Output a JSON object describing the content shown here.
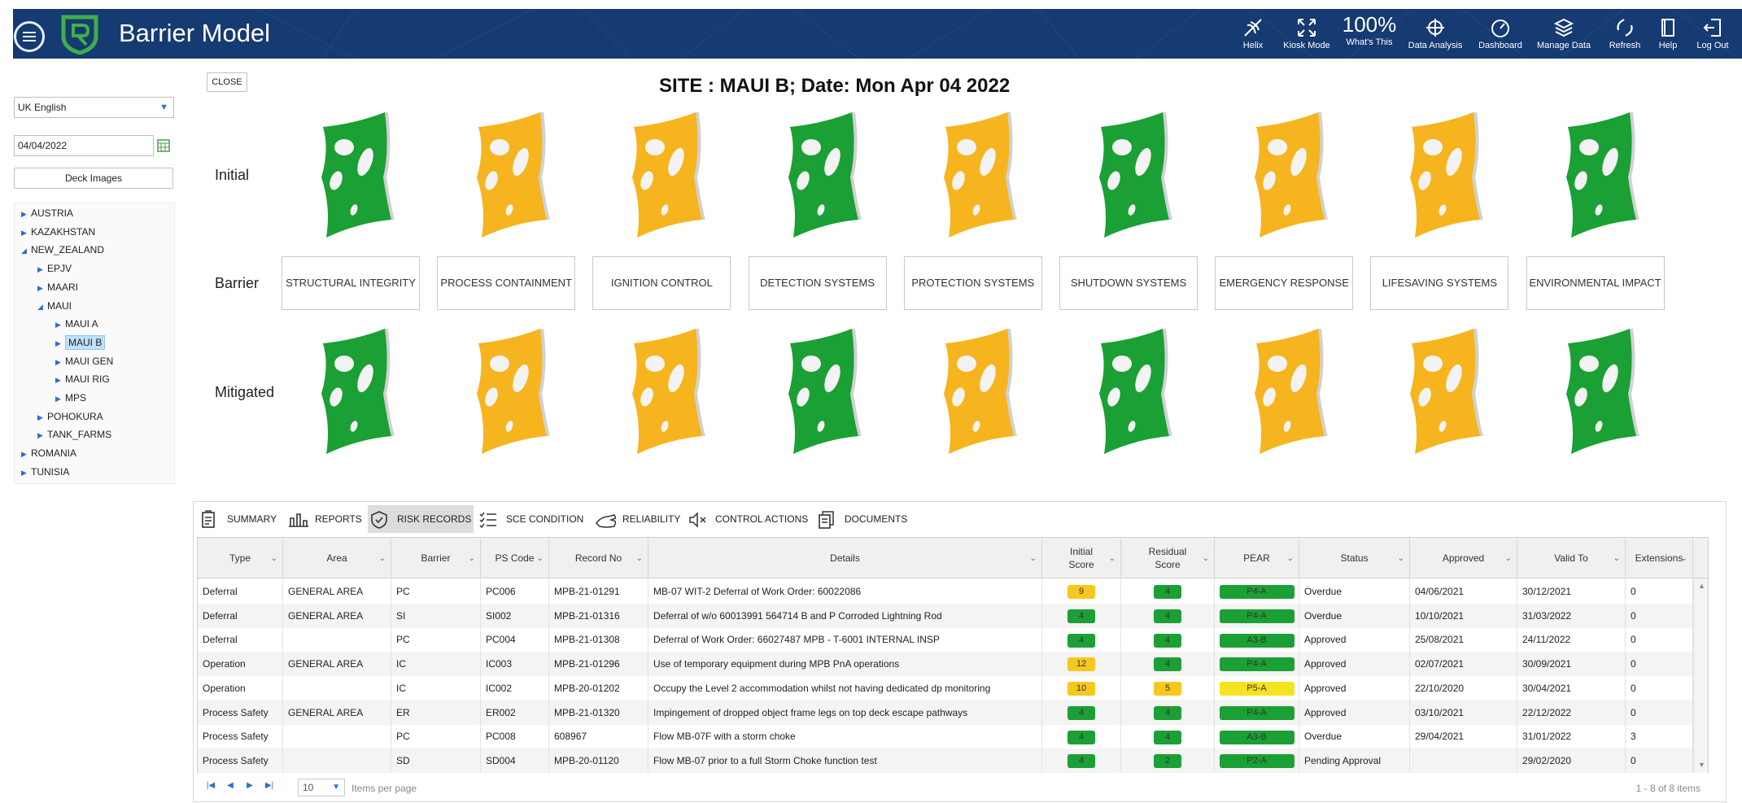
{
  "header": {
    "title": "Barrier Model",
    "zoom": "100%",
    "buttons": [
      {
        "label": "Helix",
        "icon": "helix-icon"
      },
      {
        "label": "Kiosk Mode",
        "icon": "expand-icon"
      },
      {
        "label": "What's This",
        "icon": "percent-icon"
      },
      {
        "label": "Data Analysis",
        "icon": "crosshair-icon"
      },
      {
        "label": "Dashboard",
        "icon": "gauge-icon"
      },
      {
        "label": "Manage Data",
        "icon": "layers-icon"
      },
      {
        "label": "Refresh",
        "icon": "refresh-icon"
      },
      {
        "label": "Help",
        "icon": "book-icon"
      },
      {
        "label": "Log Out",
        "icon": "logout-icon"
      }
    ],
    "bg_color": "#163a72"
  },
  "sidebar": {
    "language": "UK English",
    "date": "04/04/2022",
    "deck_images_label": "Deck Images",
    "tree": [
      {
        "label": "AUSTRIA",
        "level": 0,
        "expanded": false
      },
      {
        "label": "KAZAKHSTAN",
        "level": 0,
        "expanded": false
      },
      {
        "label": "NEW_ZEALAND",
        "level": 0,
        "expanded": true
      },
      {
        "label": "EPJV",
        "level": 1,
        "expanded": false
      },
      {
        "label": "MAARI",
        "level": 1,
        "expanded": false
      },
      {
        "label": "MAUI",
        "level": 1,
        "expanded": true
      },
      {
        "label": "MAUI A",
        "level": 2,
        "expanded": false
      },
      {
        "label": "MAUI B",
        "level": 2,
        "expanded": false,
        "selected": true
      },
      {
        "label": "MAUI GEN",
        "level": 2,
        "expanded": false
      },
      {
        "label": "MAUI RIG",
        "level": 2,
        "expanded": false
      },
      {
        "label": "MPS",
        "level": 2,
        "expanded": false
      },
      {
        "label": "POHOKURA",
        "level": 1,
        "expanded": false
      },
      {
        "label": "TANK_FARMS",
        "level": 1,
        "expanded": false
      },
      {
        "label": "ROMANIA",
        "level": 0,
        "expanded": false
      },
      {
        "label": "TUNISIA",
        "level": 0,
        "expanded": false
      }
    ]
  },
  "main": {
    "close_label": "CLOSE",
    "site_title": "SITE : MAUI B; Date: Mon Apr 04 2022",
    "row_labels": {
      "initial": "Initial",
      "barrier": "Barrier",
      "mitigated": "Mitigated"
    },
    "colors": {
      "green": "#1aa034",
      "amber": "#f6b51e"
    },
    "barriers": [
      {
        "name": "STRUCTURAL INTEGRITY",
        "initial": "green",
        "mitigated": "green"
      },
      {
        "name": "PROCESS CONTAINMENT",
        "initial": "amber",
        "mitigated": "amber"
      },
      {
        "name": "IGNITION CONTROL",
        "initial": "amber",
        "mitigated": "amber"
      },
      {
        "name": "DETECTION SYSTEMS",
        "initial": "green",
        "mitigated": "green"
      },
      {
        "name": "PROTECTION SYSTEMS",
        "initial": "amber",
        "mitigated": "amber"
      },
      {
        "name": "SHUTDOWN SYSTEMS",
        "initial": "green",
        "mitigated": "green"
      },
      {
        "name": "EMERGENCY RESPONSE",
        "initial": "amber",
        "mitigated": "amber"
      },
      {
        "name": "LIFESAVING SYSTEMS",
        "initial": "amber",
        "mitigated": "amber"
      },
      {
        "name": "ENVIRONMENTAL IMPACT",
        "initial": "green",
        "mitigated": "green"
      }
    ]
  },
  "tabs": [
    {
      "label": "SUMMARY",
      "icon": "clipboard-icon"
    },
    {
      "label": "REPORTS",
      "icon": "bar-chart-icon"
    },
    {
      "label": "RISK RECORDS",
      "icon": "shield-check-icon",
      "active": true
    },
    {
      "label": "SCE CONDITION",
      "icon": "checklist-icon"
    },
    {
      "label": "RELIABILITY",
      "icon": "hand-icon"
    },
    {
      "label": "CONTROL ACTIONS",
      "icon": "mute-icon"
    },
    {
      "label": "DOCUMENTS",
      "icon": "documents-icon"
    }
  ],
  "table": {
    "columns": [
      "Type",
      "Area",
      "Barrier",
      "PS Code",
      "Record No",
      "Details",
      "Initial Score",
      "Residual Score",
      "PEAR",
      "Status",
      "Approved",
      "Valid To",
      "Extensions"
    ],
    "rows": [
      {
        "type": "Deferral",
        "area": "GENERAL AREA",
        "barrier": "PC",
        "ps_code": "PC006",
        "record_no": "MPB-21-01291",
        "details": "MB-07 WIT-2 Deferral of Work Order: 60022086",
        "initial": "9",
        "initial_color": "#f6c81e",
        "residual": "4",
        "residual_color": "#1aa034",
        "pear": "P4-A",
        "pear_color": "#1aa034",
        "status": "Overdue",
        "approved": "04/06/2021",
        "valid_to": "30/12/2021",
        "extensions": "0"
      },
      {
        "type": "Deferral",
        "area": "GENERAL AREA",
        "barrier": "SI",
        "ps_code": "SI002",
        "record_no": "MPB-21-01316",
        "details": "Deferral of w/o 60013991 564714 B and P Corroded Lightning Rod",
        "initial": "4",
        "initial_color": "#1aa034",
        "residual": "4",
        "residual_color": "#1aa034",
        "pear": "P4-A",
        "pear_color": "#1aa034",
        "status": "Overdue",
        "approved": "10/10/2021",
        "valid_to": "31/03/2022",
        "extensions": "0"
      },
      {
        "type": "Deferral",
        "area": "",
        "barrier": "PC",
        "ps_code": "PC004",
        "record_no": "MPB-21-01308",
        "details": "Deferral of Work Order: 66027487 MPB - T-6001 INTERNAL INSP",
        "initial": "4",
        "initial_color": "#1aa034",
        "residual": "4",
        "residual_color": "#1aa034",
        "pear": "A3-B",
        "pear_color": "#1aa034",
        "status": "Approved",
        "approved": "25/08/2021",
        "valid_to": "24/11/2022",
        "extensions": "0"
      },
      {
        "type": "Operation",
        "area": "GENERAL AREA",
        "barrier": "IC",
        "ps_code": "IC003",
        "record_no": "MPB-21-01296",
        "details": "Use of temporary equipment during MPB PnA operations",
        "initial": "12",
        "initial_color": "#f6c81e",
        "residual": "4",
        "residual_color": "#1aa034",
        "pear": "P4-A",
        "pear_color": "#1aa034",
        "status": "Approved",
        "approved": "02/07/2021",
        "valid_to": "30/09/2021",
        "extensions": "0"
      },
      {
        "type": "Operation",
        "area": "",
        "barrier": "IC",
        "ps_code": "IC002",
        "record_no": "MPB-20-01202",
        "details": "Occupy the Level 2 accommodation whilst not having dedicated dp monitoring",
        "initial": "10",
        "initial_color": "#f6c81e",
        "residual": "5",
        "residual_color": "#f6c81e",
        "pear": "P5-A",
        "pear_color": "#f6e21e",
        "status": "Approved",
        "approved": "22/10/2020",
        "valid_to": "30/04/2021",
        "extensions": "0"
      },
      {
        "type": "Process Safety",
        "area": "GENERAL AREA",
        "barrier": "ER",
        "ps_code": "ER002",
        "record_no": "MPB-21-01320",
        "details": "Impingement of dropped object frame legs on top deck escape pathways",
        "initial": "4",
        "initial_color": "#1aa034",
        "residual": "4",
        "residual_color": "#1aa034",
        "pear": "P4-A",
        "pear_color": "#1aa034",
        "status": "Approved",
        "approved": "03/10/2021",
        "valid_to": "22/12/2022",
        "extensions": "0"
      },
      {
        "type": "Process Safety",
        "area": "",
        "barrier": "PC",
        "ps_code": "PC008",
        "record_no": "608967",
        "details": "Flow MB-07F with a storm choke",
        "initial": "4",
        "initial_color": "#1aa034",
        "residual": "4",
        "residual_color": "#1aa034",
        "pear": "A3-B",
        "pear_color": "#1aa034",
        "status": "Overdue",
        "approved": "29/04/2021",
        "valid_to": "31/01/2022",
        "extensions": "3"
      },
      {
        "type": "Process Safety",
        "area": "",
        "barrier": "SD",
        "ps_code": "SD004",
        "record_no": "MPB-20-01120",
        "details": "Flow MB-07 prior to a full Storm Choke function test",
        "initial": "4",
        "initial_color": "#1aa034",
        "residual": "2",
        "residual_color": "#1aa034",
        "pear": "P2-A",
        "pear_color": "#1aa034",
        "status": "Pending Approval",
        "approved": "",
        "valid_to": "29/02/2020",
        "extensions": "0"
      }
    ]
  },
  "pager": {
    "page_size": "10",
    "items_per_page_label": "Items per page",
    "range_label": "1 - 8 of 8 items"
  }
}
